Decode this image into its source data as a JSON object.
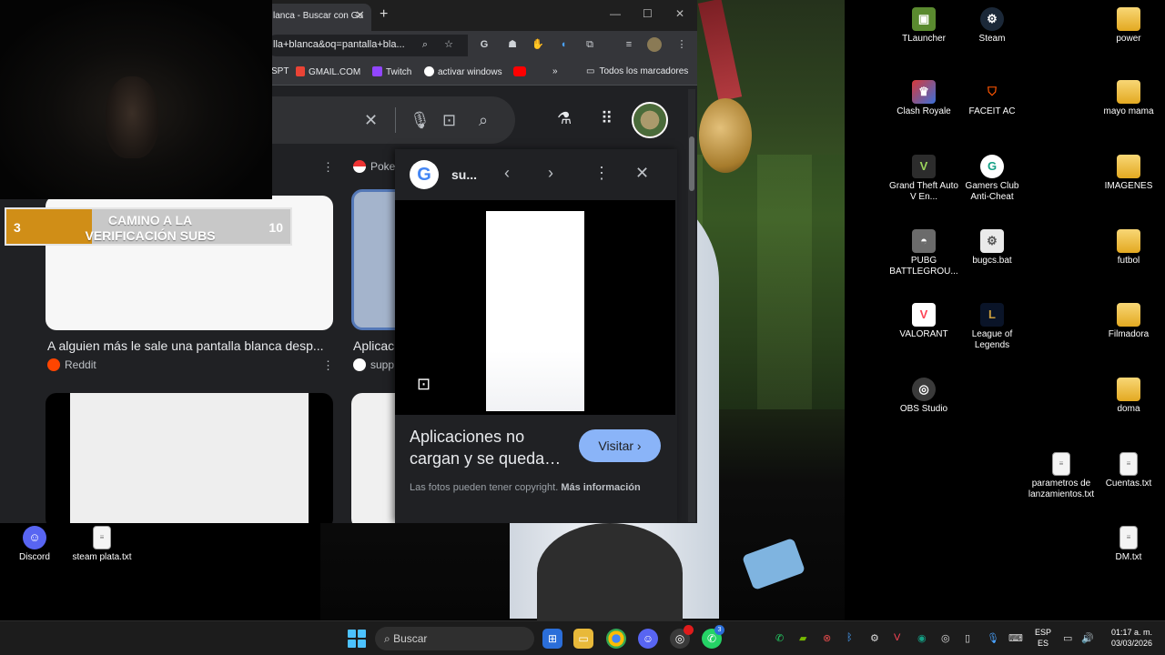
{
  "browser": {
    "tab_title": "lanca - Buscar con Go",
    "url": "lla+blanca&oq=pantalla+bla...",
    "bookmarks": [
      "SPT",
      "GMAIL.COM",
      "Twitch",
      "activar windows",
      "Todos los marcadores"
    ],
    "overflow_label": "»"
  },
  "results": {
    "chip_label": "Poke",
    "result1_title": "A alguien más le sale una pantalla blanca desp...",
    "result1_source": "Reddit",
    "result2_title": "Aplicac",
    "result2_source": "supp"
  },
  "panel": {
    "site": "su...",
    "title": "Aplicaciones no cargan y se queda…",
    "visit_label": "Visitar",
    "copyright_text": "Las fotos pueden tener copyright.",
    "more_info": "Más información"
  },
  "overlay": {
    "goal_start": "3",
    "goal_end": "10",
    "goal_label": "CAMINO A LA VERIFICACIÓN SUBS",
    "progress_fraction": 0.3
  },
  "desktop": {
    "left_icons": [
      "Discord",
      "steam plata.txt"
    ],
    "col1": [
      "TLauncher",
      "Clash Royale",
      "Grand Theft Auto V En...",
      "PUBG BATTLEGROU...",
      "VALORANT",
      "OBS Studio"
    ],
    "col2": [
      "Steam",
      "FACEIT AC",
      "Gamers Club Anti-Cheat",
      "bugcs.bat",
      "League of Legends",
      "parametros de lanzamientos.txt"
    ],
    "col3": [
      "power",
      "mayo mama",
      "IMAGENES",
      "futbol",
      "Filmadora",
      "doma",
      "Cuentas.txt",
      "DM.txt"
    ]
  },
  "taskbar": {
    "search_placeholder": "Buscar",
    "lang_top": "ESP",
    "lang_bottom": "ES",
    "time": "01:17 a. m.",
    "date": "03/03/2026",
    "whatsapp_badge": "3"
  },
  "colors": {
    "accent_blue": "#8ab4f8",
    "goal_orange": "#d08e17",
    "chrome_dark": "#202124"
  }
}
